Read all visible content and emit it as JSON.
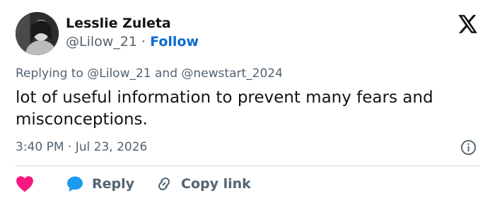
{
  "author": {
    "name": "Lesslie Zuleta",
    "handle": "@Lilow_21",
    "separator": "·",
    "follow_label": "Follow"
  },
  "reply_context": {
    "prefix": "Replying to",
    "user1": "@Lilow_21",
    "conjunction": "and",
    "user2": "@newstart_2024"
  },
  "tweet": {
    "text": "lot of useful information to prevent many fears and misconceptions.",
    "time": "3:40 PM",
    "separator": "·",
    "date": "Jul 23, 2026"
  },
  "actions": {
    "like_icon": "heart-icon",
    "reply_label": "Reply",
    "copy_label": "Copy link"
  },
  "colors": {
    "accent": "#0c6ad1",
    "like": "#f91880",
    "reply_bubble": "#1d9bf0",
    "secondary_text": "#536471",
    "primary_text": "#0f1419"
  }
}
